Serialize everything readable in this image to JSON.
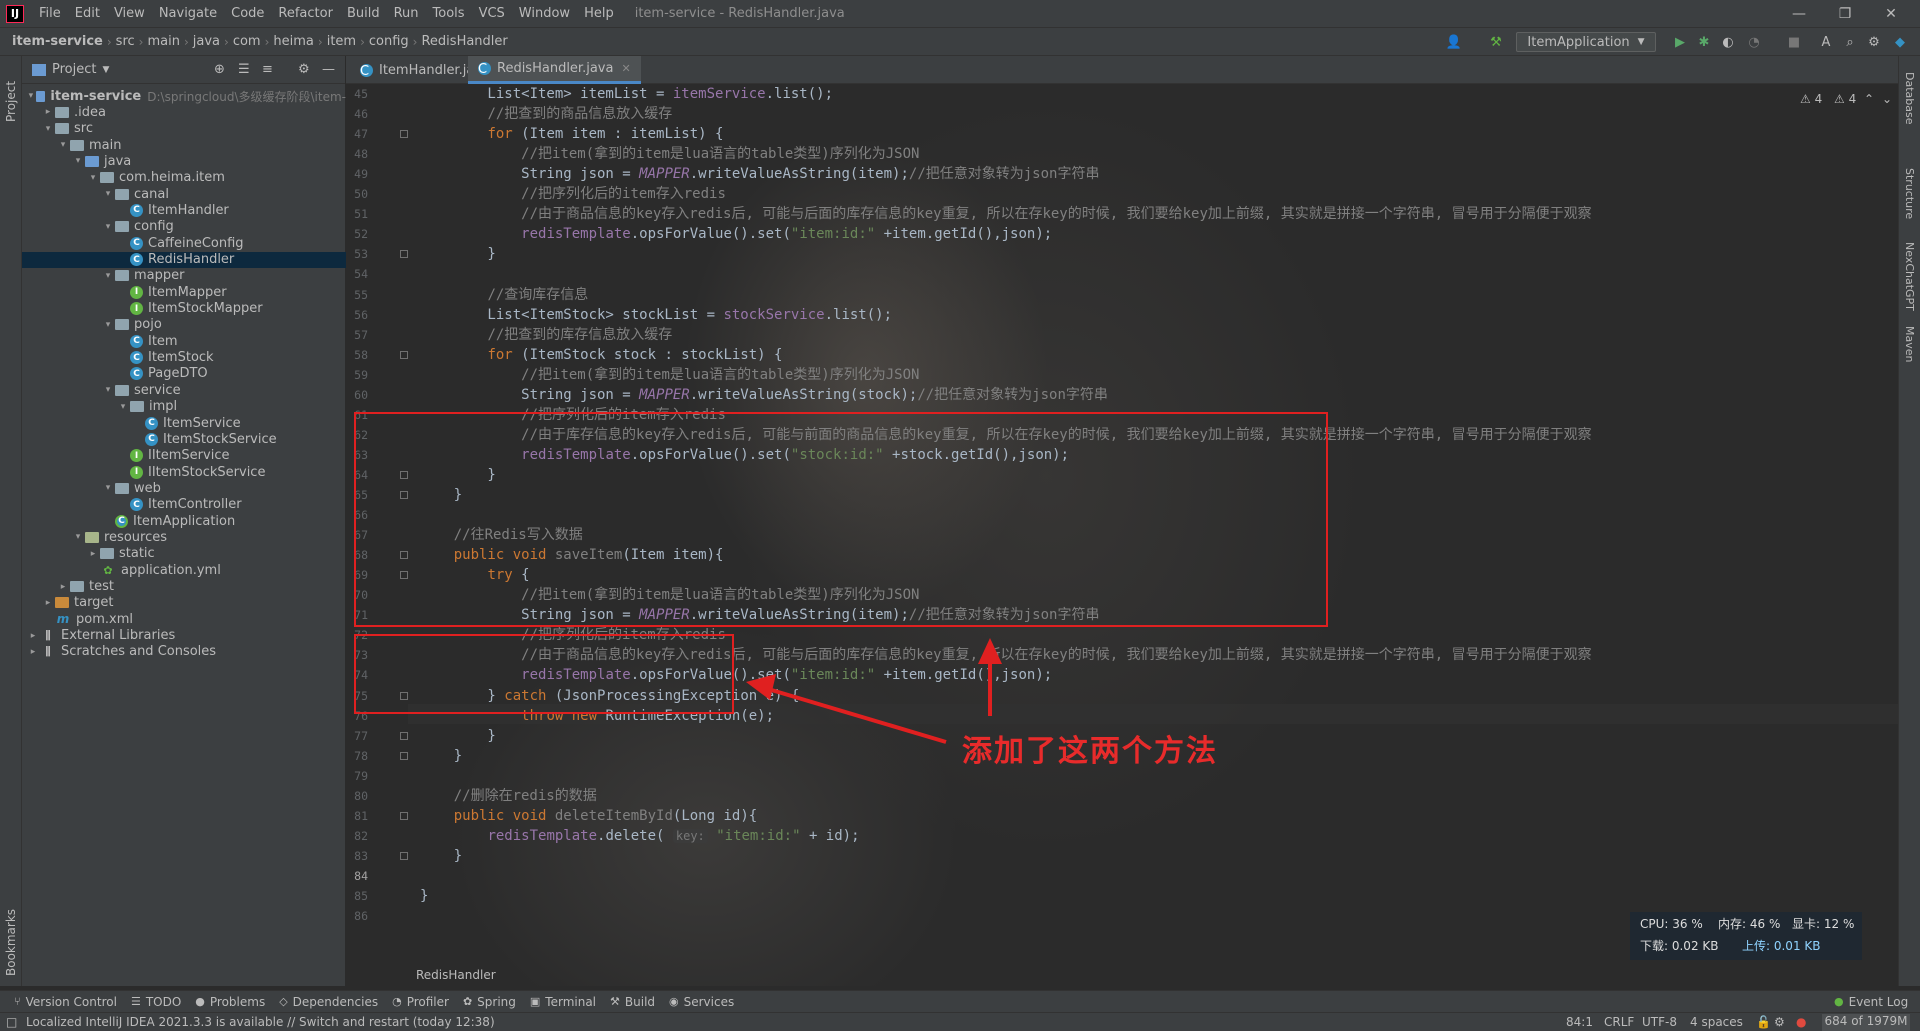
{
  "menubar": {
    "logo": "IJ",
    "items": [
      "File",
      "Edit",
      "View",
      "Navigate",
      "Code",
      "Refactor",
      "Build",
      "Run",
      "Tools",
      "VCS",
      "Window",
      "Help"
    ],
    "title": "item-service - RedisHandler.java"
  },
  "breadcrumb": [
    "item-service",
    "src",
    "main",
    "java",
    "com",
    "heima",
    "item",
    "config",
    "RedisHandler"
  ],
  "run_config": "ItemApplication",
  "project_panel": {
    "title": "Project",
    "tree": [
      {
        "label": "item-service",
        "path": "D:\\springcloud\\多级缓存阶段\\item-",
        "icon": "folder-blue",
        "depth": 0,
        "arrow": "▾"
      },
      {
        "label": ".idea",
        "icon": "folder",
        "depth": 1,
        "arrow": "▸"
      },
      {
        "label": "src",
        "icon": "folder",
        "depth": 1,
        "arrow": "▾"
      },
      {
        "label": "main",
        "icon": "folder",
        "depth": 2,
        "arrow": "▾"
      },
      {
        "label": "java",
        "icon": "folder-blue",
        "depth": 3,
        "arrow": "▾"
      },
      {
        "label": "com.heima.item",
        "icon": "folder",
        "depth": 4,
        "arrow": "▾"
      },
      {
        "label": "canal",
        "icon": "folder",
        "depth": 5,
        "arrow": "▾"
      },
      {
        "label": "ItemHandler",
        "icon": "class",
        "depth": 6,
        "arrow": ""
      },
      {
        "label": "config",
        "icon": "folder",
        "depth": 5,
        "arrow": "▾"
      },
      {
        "label": "CaffeineConfig",
        "icon": "class",
        "depth": 6,
        "arrow": ""
      },
      {
        "label": "RedisHandler",
        "icon": "class",
        "depth": 6,
        "arrow": "",
        "selected": true
      },
      {
        "label": "mapper",
        "icon": "folder",
        "depth": 5,
        "arrow": "▾"
      },
      {
        "label": "ItemMapper",
        "icon": "interface",
        "depth": 6,
        "arrow": ""
      },
      {
        "label": "ItemStockMapper",
        "icon": "interface",
        "depth": 6,
        "arrow": ""
      },
      {
        "label": "pojo",
        "icon": "folder",
        "depth": 5,
        "arrow": "▾"
      },
      {
        "label": "Item",
        "icon": "class",
        "depth": 6,
        "arrow": ""
      },
      {
        "label": "ItemStock",
        "icon": "class",
        "depth": 6,
        "arrow": ""
      },
      {
        "label": "PageDTO",
        "icon": "class",
        "depth": 6,
        "arrow": ""
      },
      {
        "label": "service",
        "icon": "folder",
        "depth": 5,
        "arrow": "▾"
      },
      {
        "label": "impl",
        "icon": "folder",
        "depth": 6,
        "arrow": "▾"
      },
      {
        "label": "ItemService",
        "icon": "class",
        "depth": 7,
        "arrow": ""
      },
      {
        "label": "ItemStockService",
        "icon": "class",
        "depth": 7,
        "arrow": ""
      },
      {
        "label": "IItemService",
        "icon": "interface",
        "depth": 6,
        "arrow": ""
      },
      {
        "label": "IItemStockService",
        "icon": "interface",
        "depth": 6,
        "arrow": ""
      },
      {
        "label": "web",
        "icon": "folder",
        "depth": 5,
        "arrow": "▾"
      },
      {
        "label": "ItemController",
        "icon": "class",
        "depth": 6,
        "arrow": ""
      },
      {
        "label": "ItemApplication",
        "icon": "app",
        "depth": 5,
        "arrow": ""
      },
      {
        "label": "resources",
        "icon": "folder-res",
        "depth": 3,
        "arrow": "▾"
      },
      {
        "label": "static",
        "icon": "folder",
        "depth": 4,
        "arrow": "▸"
      },
      {
        "label": "application.yml",
        "icon": "yml",
        "depth": 4,
        "arrow": ""
      },
      {
        "label": "test",
        "icon": "folder",
        "depth": 2,
        "arrow": "▸"
      },
      {
        "label": "target",
        "icon": "folder-orange",
        "depth": 1,
        "arrow": "▸"
      },
      {
        "label": "pom.xml",
        "icon": "maven",
        "depth": 1,
        "arrow": ""
      },
      {
        "label": "External Libraries",
        "icon": "lib",
        "depth": 0,
        "arrow": "▸"
      },
      {
        "label": "Scratches and Consoles",
        "icon": "lib",
        "depth": 0,
        "arrow": "▸"
      }
    ]
  },
  "tabs": [
    {
      "label": "ItemHandler.java",
      "active": false
    },
    {
      "label": "RedisHandler.java",
      "active": true
    }
  ],
  "editor": {
    "warnings": [
      "⚠ 4",
      "⚠ 4"
    ],
    "bottom_breadcrumb": "RedisHandler",
    "lines": [
      {
        "n": "45",
        "html": "        List&lt;Item&gt; itemList = <span class=\"fld\" style=\"font-style:normal;color:#9876aa\">itemService</span>.list();"
      },
      {
        "n": "46",
        "html": "        <span class=\"cm\">//把查到的商品信息放入缓存</span>"
      },
      {
        "n": "47",
        "html": "        <span class=\"kw\">for</span> (Item item : itemList) {"
      },
      {
        "n": "48",
        "html": "            <span class=\"cm\">//把item(拿到的item是lua语言的table类型)序列化为JSON</span>"
      },
      {
        "n": "49",
        "html": "            String json = <span class=\"fld\">MAPPER</span>.writeValueAsString(item);<span class=\"cm\">//把任意对象转为json字符串</span>"
      },
      {
        "n": "50",
        "html": "            <span class=\"cm\">//把序列化后的item存入redis</span>"
      },
      {
        "n": "51",
        "html": "            <span class=\"cm\">//由于商品信息的key存入redis后, 可能与后面的库存信息的key重复, 所以在存key的时候, 我们要给key加上前缀, 其实就是拼接一个字符串, 冒号用于分隔便于观察</span>"
      },
      {
        "n": "52",
        "html": "            <span style=\"color:#9876aa\">redisTemplate</span>.opsForValue().set(<span class=\"st\">\"item:id:\"</span> +item.getId(),json);"
      },
      {
        "n": "53",
        "html": "        }"
      },
      {
        "n": "54",
        "html": ""
      },
      {
        "n": "55",
        "html": "        <span class=\"cm\">//查询库存信息</span>"
      },
      {
        "n": "56",
        "html": "        List&lt;ItemStock&gt; stockList = <span style=\"color:#9876aa\">stockService</span>.list();"
      },
      {
        "n": "57",
        "html": "        <span class=\"cm\">//把查到的库存信息放入缓存</span>"
      },
      {
        "n": "58",
        "html": "        <span class=\"kw\">for</span> (ItemStock stock : stockList) {"
      },
      {
        "n": "59",
        "html": "            <span class=\"cm\">//把item(拿到的item是lua语言的table类型)序列化为JSON</span>"
      },
      {
        "n": "60",
        "html": "            String json = <span class=\"fld\">MAPPER</span>.writeValueAsString(stock);<span class=\"cm\">//把任意对象转为json字符串</span>"
      },
      {
        "n": "61",
        "html": "            <span class=\"cm\">//把序列化后的item存入redis</span>"
      },
      {
        "n": "62",
        "html": "            <span class=\"cm\">//由于库存信息的key存入redis后, 可能与前面的商品信息的key重复, 所以在存key的时候, 我们要给key加上前缀, 其实就是拼接一个字符串, 冒号用于分隔便于观察</span>"
      },
      {
        "n": "63",
        "html": "            <span style=\"color:#9876aa\">redisTemplate</span>.opsForValue().set(<span class=\"st\">\"stock:id:\"</span> +stock.getId(),json);"
      },
      {
        "n": "64",
        "html": "        }"
      },
      {
        "n": "65",
        "html": "    }"
      },
      {
        "n": "66",
        "html": ""
      },
      {
        "n": "67",
        "html": "    <span class=\"cm\">//往Redis写入数据</span>"
      },
      {
        "n": "68",
        "html": "    <span class=\"kw\">public void</span> <span class=\"mth\" style=\"color:#808080\">saveItem</span>(Item item){"
      },
      {
        "n": "69",
        "html": "        <span class=\"kw\">try</span> {"
      },
      {
        "n": "70",
        "html": "            <span class=\"cm\">//把item(拿到的item是lua语言的table类型)序列化为JSON</span>"
      },
      {
        "n": "71",
        "html": "            String json = <span class=\"fld\">MAPPER</span>.writeValueAsString(item);<span class=\"cm\">//把任意对象转为json字符串</span>"
      },
      {
        "n": "72",
        "html": "            <span class=\"cm\">//把序列化后的item存入redis</span>"
      },
      {
        "n": "73",
        "html": "            <span class=\"cm\">//由于商品信息的key存入redis后, 可能与后面的库存信息的key重复, 所以在存key的时候, 我们要给key加上前缀, 其实就是拼接一个字符串, 冒号用于分隔便于观察</span>"
      },
      {
        "n": "74",
        "html": "            <span style=\"color:#9876aa\">redisTemplate</span>.opsForValue().set(<span class=\"st\">\"item:id:\"</span> +item.getId(),json);"
      },
      {
        "n": "75",
        "html": "        } <span class=\"kw\">catch</span> (JsonProcessingException e) {"
      },
      {
        "n": "76",
        "html": "            <span class=\"kw\">throw new</span> RuntimeException(e);"
      },
      {
        "n": "77",
        "html": "        }"
      },
      {
        "n": "78",
        "html": "    }"
      },
      {
        "n": "79",
        "html": ""
      },
      {
        "n": "80",
        "html": "    <span class=\"cm\">//删除在redis的数据</span>"
      },
      {
        "n": "81",
        "html": "    <span class=\"kw\">public void</span> <span style=\"color:#808080\">deleteItemById</span>(Long id){"
      },
      {
        "n": "82",
        "html": "        <span style=\"color:#9876aa\">redisTemplate</span>.delete( <span class=\"hint\">key:</span> <span class=\"st\">\"item:id:\"</span> + id);"
      },
      {
        "n": "83",
        "html": "    }"
      },
      {
        "n": "84",
        "html": ""
      },
      {
        "n": "85",
        "html": "}"
      },
      {
        "n": "86",
        "html": ""
      }
    ]
  },
  "annotation": "添加了这两个方法",
  "perf": {
    "cpu": "CPU: 36 %",
    "mem": "内存: 46 %",
    "gpu": "显卡: 12 %",
    "down": "下载: 0.02 KB",
    "up": "上传: 0.01 KB"
  },
  "tool_windows": [
    "Version Control",
    "TODO",
    "Problems",
    "Dependencies",
    "Profiler",
    "Spring",
    "Terminal",
    "Build",
    "Services"
  ],
  "event_log": "Event Log",
  "status": {
    "message": "Localized IntelliJ IDEA 2021.3.3 is available // Switch and restart (today 12:38)",
    "position": "84:1",
    "line_sep": "CRLF",
    "encoding": "UTF-8",
    "indent": "4 spaces",
    "memory": "684 of 1979M"
  },
  "side_labels": {
    "project": "Project",
    "bookmarks": "Bookmarks",
    "database": "Database",
    "structure": "Structure",
    "nexchat": "NexChatGPT",
    "maven": "Maven"
  }
}
